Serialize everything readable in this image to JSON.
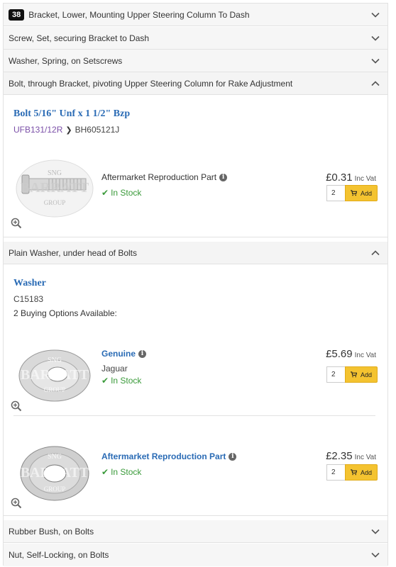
{
  "sections": {
    "s1": {
      "badge": "38",
      "label": "Bracket, Lower, Mounting Upper Steering Column To Dash"
    },
    "s2": {
      "label": "Screw, Set, securing Bracket to Dash"
    },
    "s3": {
      "label": "Washer, Spring, on Setscrews"
    },
    "s4": {
      "label": "Bolt, through Bracket, pivoting Upper Steering Column for Rake Adjustment"
    },
    "s5": {
      "label": "Plain Washer, under head of Bolts"
    },
    "s6": {
      "label": "Rubber Bush, on Bolts"
    },
    "s7": {
      "label": "Nut, Self-Locking, on Bolts"
    }
  },
  "bolt": {
    "title": "Bolt 5/16\" Unf x 1 1/2\" Bzp",
    "old_code": "UFB131/12R",
    "new_code": "BH605121J",
    "option": {
      "name": "Aftermarket Reproduction Part",
      "stock": "In Stock",
      "price": "£0.31",
      "vat": "Inc Vat",
      "qty": "2",
      "add_label": "Add"
    }
  },
  "washer": {
    "title": "Washer",
    "code": "C15183",
    "buying_note": "2 Buying Options Available:",
    "options": [
      {
        "name": "Genuine",
        "brand": "Jaguar",
        "stock": "In Stock",
        "price": "£5.69",
        "vat": "Inc Vat",
        "qty": "2",
        "add_label": "Add"
      },
      {
        "name": "Aftermarket Reproduction Part",
        "stock": "In Stock",
        "price": "£2.35",
        "vat": "Inc Vat",
        "qty": "2",
        "add_label": "Add"
      }
    ]
  },
  "watermark": {
    "line1": "SNG",
    "line2": "BARRATT",
    "line3": "GROUP"
  },
  "colors": {
    "link": "#2a6bb5",
    "stock": "#3a9a3a",
    "add_button": "#f4c330",
    "old_code": "#7b4fa8"
  },
  "icons": {
    "expand": "chevron-down-icon",
    "collapse": "chevron-up-icon",
    "zoom": "zoom-in-icon",
    "info": "info-icon",
    "cart": "cart-icon",
    "tick": "check-icon"
  }
}
